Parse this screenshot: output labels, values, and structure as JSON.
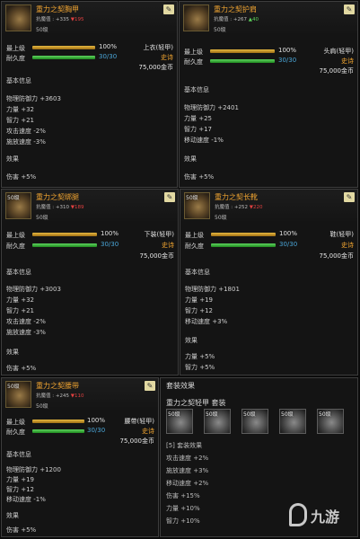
{
  "panels": [
    {
      "title": "重力之契胸甲",
      "anti": "抗魔值 : +335",
      "anti_down": "▼195",
      "level": "50级",
      "icon_level": "",
      "rows": {
        "max": "最上级",
        "max_pct": "100%",
        "dur": "耐久度",
        "dur_val": "30/30",
        "type": "上衣(轻甲)",
        "rarity": "史诗",
        "price": "75,000金币"
      },
      "section": "基本信息",
      "stats": [
        "物理防御力 +3603",
        "力量 +32",
        "智力 +21",
        "攻击速度 -2%",
        "施放速度 -3%"
      ],
      "effect": "效果",
      "effects": [
        "伤害 +5%"
      ]
    },
    {
      "title": "重力之契护肩",
      "anti": "抗魔值 : +267",
      "anti_up": "▲40",
      "level": "50级",
      "icon_level": "",
      "rows": {
        "max": "最上级",
        "max_pct": "100%",
        "dur": "耐久度",
        "dur_val": "30/30",
        "type": "头肩(轻甲)",
        "rarity": "史诗",
        "price": "75,000金币"
      },
      "section": "基本信息",
      "stats": [
        "物理防御力 +2401",
        "力量 +25",
        "智力 +17",
        "移动速度 -1%"
      ],
      "effect": "效果",
      "effects": [
        "伤害 +5%"
      ]
    },
    {
      "title": "重力之契绑腿",
      "anti": "抗魔值 : +310",
      "anti_down": "▼189",
      "level": "50级",
      "icon_level": "50级",
      "rows": {
        "max": "最上级",
        "max_pct": "100%",
        "dur": "耐久度",
        "dur_val": "30/30",
        "type": "下装(轻甲)",
        "rarity": "史诗",
        "price": "75,000金币"
      },
      "section": "基本信息",
      "stats": [
        "物理防御力 +3003",
        "力量 +32",
        "智力 +21",
        "攻击速度 -2%",
        "施放速度 -3%"
      ],
      "effect": "效果",
      "effects": [
        "伤害 +5%"
      ]
    },
    {
      "title": "重力之契长靴",
      "anti": "抗魔值 : +252",
      "anti_down": "▼220",
      "level": "50级",
      "icon_level": "50级",
      "rows": {
        "max": "最上级",
        "max_pct": "100%",
        "dur": "耐久度",
        "dur_val": "30/30",
        "type": "鞋(轻甲)",
        "rarity": "史诗",
        "price": "75,000金币"
      },
      "section": "基本信息",
      "stats": [
        "物理防御力 +1801",
        "力量 +19",
        "智力 +12",
        "移动速度 +3%"
      ],
      "effect": "效果",
      "effects": [
        "力量 +5%",
        "智力 +5%"
      ]
    },
    {
      "title": "重力之契腰带",
      "anti": "抗魔值 : +245",
      "anti_down": "▼110",
      "level": "50级",
      "icon_level": "50级",
      "rows": {
        "max": "最上级",
        "max_pct": "100%",
        "dur": "耐久度",
        "dur_val": "30/30",
        "type": "腰带(轻甲)",
        "rarity": "史诗",
        "price": "75,000金币"
      },
      "section": "基本信息",
      "stats": [
        "物理防御力 +1200",
        "力量 +19",
        "智力 +12",
        "移动速度 -1%"
      ],
      "effect": "效果",
      "effects": [
        "伤害 +5%"
      ]
    }
  ],
  "set_panel": {
    "header": "套装效果",
    "set_name": "重力之契轻甲 套装",
    "slots": [
      "50级",
      "50级",
      "50级",
      "50级",
      "50级"
    ],
    "bonus_title": "[5] 套装效果",
    "bonus_lines": [
      "攻击速度 +2%",
      "施放速度 +3%",
      "移动速度 +2%",
      "伤害 +15%",
      "力量 +10%",
      "智力 +10%"
    ]
  },
  "watermark": "九游",
  "colors": {
    "title": "#f0a431",
    "durability": "#4aa6d8",
    "up": "#5bd35b",
    "down": "#e04040"
  }
}
